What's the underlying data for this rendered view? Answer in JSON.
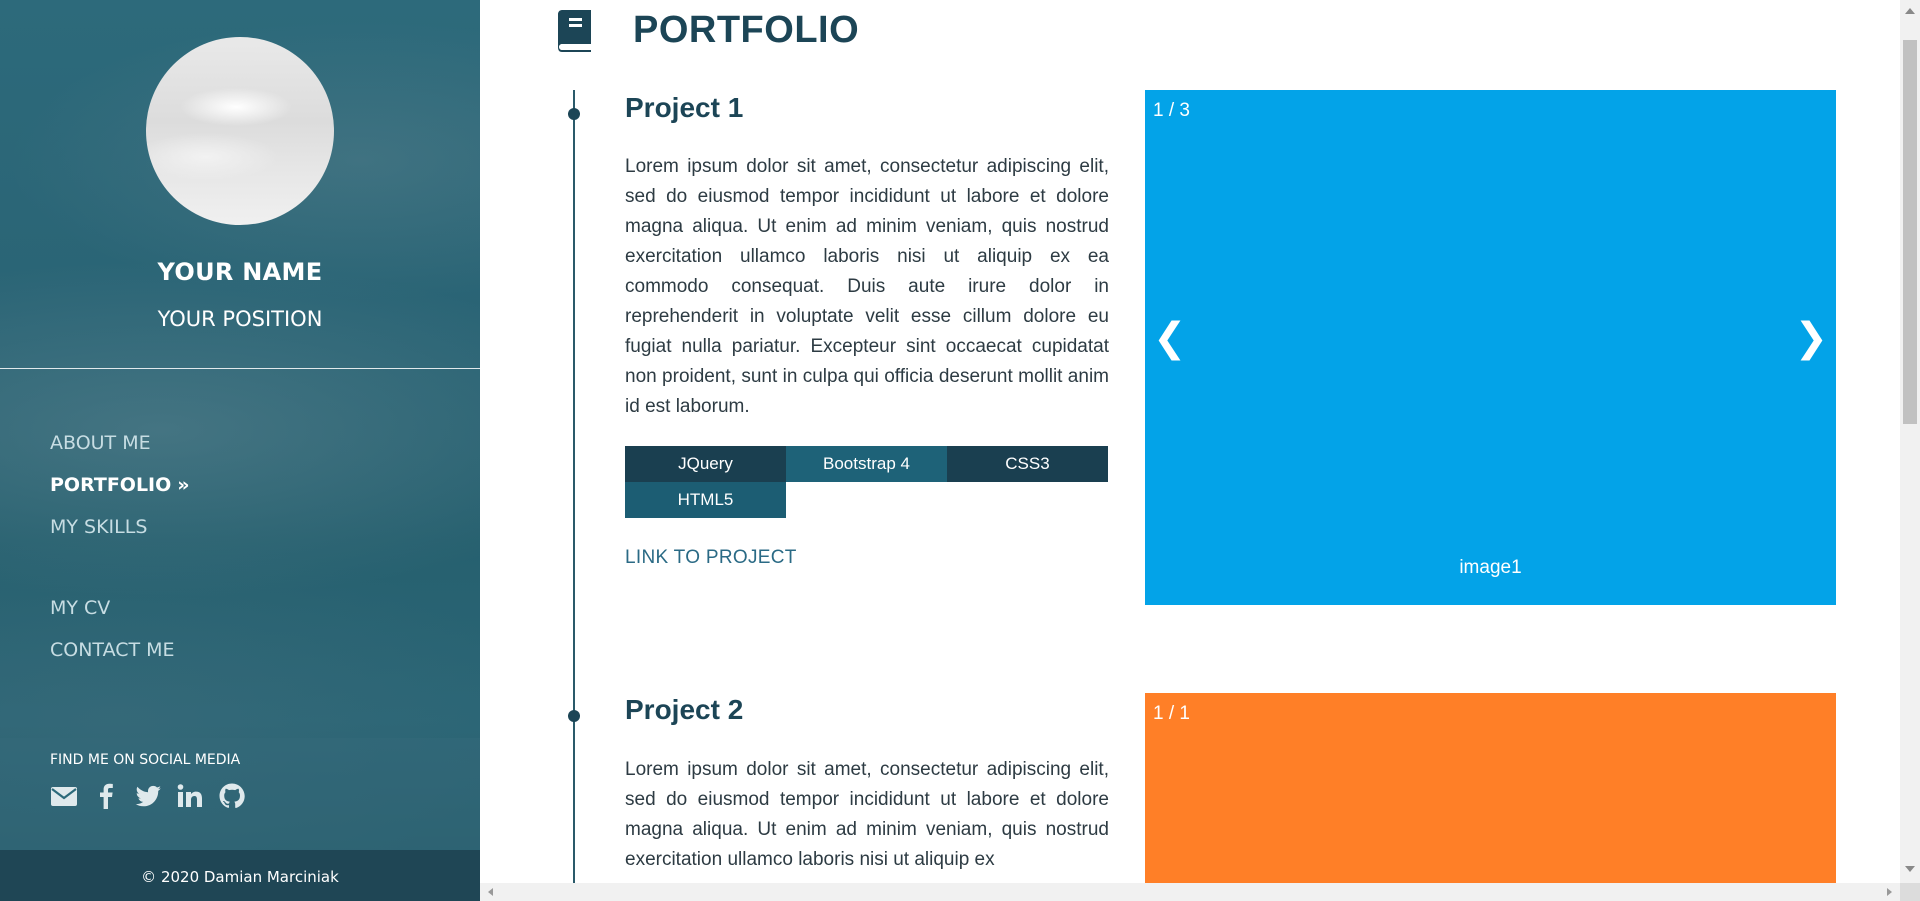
{
  "sidebar": {
    "name": "YOUR NAME",
    "position": "YOUR POSITION",
    "nav": [
      {
        "label": "ABOUT ME",
        "active": false
      },
      {
        "label": "PORTFOLIO",
        "active": true,
        "arrow": "»"
      },
      {
        "label": "MY SKILLS",
        "active": false
      },
      {
        "label": "MY CV",
        "active": false
      },
      {
        "label": "CONTACT ME",
        "active": false
      }
    ],
    "social": {
      "title": "FIND ME ON SOCIAL MEDIA",
      "icons": [
        "envelope-icon",
        "facebook-icon",
        "twitter-icon",
        "linkedin-icon",
        "github-icon"
      ]
    },
    "footer": "© 2020 Damian Marciniak"
  },
  "main": {
    "title": "PORTFOLIO",
    "icon": "book-icon",
    "projects": [
      {
        "title": "Project 1",
        "description": "Lorem ipsum dolor sit amet, consectetur adipiscing elit, sed do eiusmod tempor incididunt ut labore et dolore magna aliqua. Ut enim ad minim veniam, quis nostrud exercitation ullamco laboris nisi ut aliquip ex ea commodo consequat. Duis aute irure dolor in reprehenderit in voluptate velit esse cillum dolore eu fugiat nulla pariatur. Excepteur sint occaecat cupidatat non proident, sunt in culpa qui officia deserunt mollit anim id est laborum.",
        "tags": [
          "JQuery",
          "Bootstrap 4",
          "CSS3",
          "HTML5"
        ],
        "link": "LINK TO PROJECT",
        "carousel": {
          "counter": "1 / 3",
          "caption": "image1",
          "prev": "❮",
          "next": "❯",
          "color": "#03a3e8"
        }
      },
      {
        "title": "Project 2",
        "description": "Lorem ipsum dolor sit amet, consectetur adipiscing elit, sed do eiusmod tempor incididunt ut labore et dolore magna aliqua. Ut enim ad minim veniam, quis nostrud exercitation ullamco laboris nisi ut aliquip ex",
        "carousel": {
          "counter": "1 / 1",
          "color": "#ff7f27"
        }
      }
    ]
  },
  "colors": {
    "sidebar": "#2a6475",
    "accent": "#1c4556",
    "tag_dark": "#1a3f50",
    "tag_teal": "#1e6278",
    "link": "#2a6a85"
  }
}
